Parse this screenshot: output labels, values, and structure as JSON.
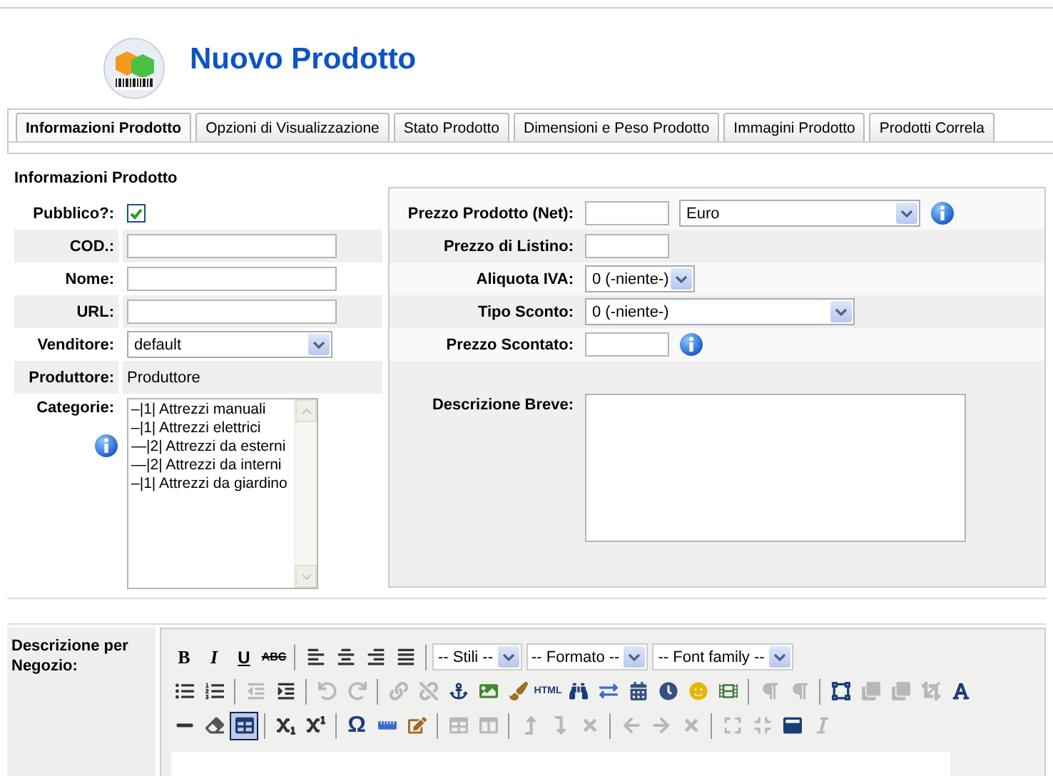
{
  "header": {
    "title": "Nuovo Prodotto"
  },
  "tabs": [
    {
      "label": "Informazioni Prodotto",
      "selected": true
    },
    {
      "label": "Opzioni di Visualizzazione",
      "selected": false
    },
    {
      "label": "Stato Prodotto",
      "selected": false
    },
    {
      "label": "Dimensioni e Peso Prodotto",
      "selected": false
    },
    {
      "label": "Immagini Prodotto",
      "selected": false
    },
    {
      "label": "Prodotti Correla",
      "selected": false
    }
  ],
  "info_section": {
    "heading": "Informazioni Prodotto",
    "rows": [
      {
        "kind": "checkbox",
        "label": "Pubblico?:",
        "checked": true
      },
      {
        "kind": "text",
        "label": "COD.:"
      },
      {
        "kind": "text",
        "label": "Nome:"
      },
      {
        "kind": "text",
        "label": "URL:"
      },
      {
        "kind": "select",
        "label": "Venditore:",
        "value": "default"
      },
      {
        "kind": "static",
        "label": "Produttore:",
        "value": "Produttore"
      },
      {
        "kind": "listbox",
        "label": "Categorie:",
        "info": true,
        "items": [
          "–|1| Attrezzi manuali",
          "–|1| Attrezzi elettrici",
          "—|2| Attrezzi da esterni",
          "—|2| Attrezzi da interni",
          "–|1| Attrezzi da giardino"
        ]
      }
    ]
  },
  "price_section": {
    "rows": [
      {
        "kind": "price",
        "label": "Prezzo Prodotto (Net):",
        "currency": "Euro",
        "info": true
      },
      {
        "kind": "text",
        "label": "Prezzo di Listino:"
      },
      {
        "kind": "dropdown",
        "label": "Aliquota IVA:",
        "value": "0 (-niente-)"
      },
      {
        "kind": "select",
        "label": "Tipo Sconto:",
        "value": "0 (-niente-)"
      },
      {
        "kind": "text",
        "label": "Prezzo Scontato:",
        "info": true
      },
      {
        "kind": "textarea",
        "label": "Descrizione Breve:"
      }
    ]
  },
  "editor": {
    "label": "Descrizione per Negozio:",
    "toolbar": [
      [
        {
          "kind": "bold",
          "label": "B",
          "disabled": false,
          "pressed": false
        },
        {
          "kind": "italic",
          "label": "I",
          "disabled": false,
          "pressed": false
        },
        {
          "kind": "underline",
          "label": "U",
          "disabled": false,
          "pressed": false
        },
        {
          "kind": "strike",
          "label": "ABC",
          "disabled": false,
          "pressed": false
        },
        {
          "kind": "separator"
        },
        {
          "kind": "align-left",
          "disabled": false,
          "pressed": false
        },
        {
          "kind": "align-center",
          "disabled": false,
          "pressed": false
        },
        {
          "kind": "align-right",
          "disabled": false,
          "pressed": false
        },
        {
          "kind": "align-justify",
          "disabled": false,
          "pressed": false
        },
        {
          "kind": "separator"
        },
        {
          "kind": "select",
          "label": "-- Stili --"
        },
        {
          "kind": "select",
          "label": "-- Formato --"
        },
        {
          "kind": "select",
          "label": "-- Font family --"
        }
      ],
      [
        {
          "kind": "bullets",
          "disabled": false,
          "pressed": false
        },
        {
          "kind": "numbers",
          "disabled": false,
          "pressed": false
        },
        {
          "kind": "separator"
        },
        {
          "kind": "outdent",
          "disabled": true,
          "pressed": false
        },
        {
          "kind": "indent",
          "disabled": false,
          "pressed": false
        },
        {
          "kind": "separator"
        },
        {
          "kind": "undo",
          "disabled": true,
          "pressed": false
        },
        {
          "kind": "redo",
          "disabled": true,
          "pressed": false
        },
        {
          "kind": "separator"
        },
        {
          "kind": "link",
          "disabled": true,
          "pressed": false
        },
        {
          "kind": "unlink",
          "disabled": true,
          "pressed": false
        },
        {
          "kind": "anchor",
          "disabled": false,
          "pressed": false
        },
        {
          "kind": "image",
          "disabled": false,
          "pressed": false
        },
        {
          "kind": "cleanup",
          "disabled": false,
          "pressed": false
        },
        {
          "kind": "html",
          "label": "HTML",
          "disabled": false,
          "pressed": false
        },
        {
          "kind": "search",
          "disabled": false,
          "pressed": false
        },
        {
          "kind": "replace",
          "disabled": false,
          "pressed": false
        },
        {
          "kind": "date",
          "disabled": false,
          "pressed": false
        },
        {
          "kind": "time",
          "disabled": false,
          "pressed": false
        },
        {
          "kind": "emoticon",
          "disabled": false,
          "pressed": false
        },
        {
          "kind": "media",
          "disabled": false,
          "pressed": false
        },
        {
          "kind": "separator"
        },
        {
          "kind": "ltr",
          "disabled": true,
          "pressed": false
        },
        {
          "kind": "rtl",
          "disabled": true,
          "pressed": false
        },
        {
          "kind": "separator"
        },
        {
          "kind": "visual-aid",
          "disabled": false,
          "pressed": false
        },
        {
          "kind": "layer-back",
          "disabled": true,
          "pressed": false
        },
        {
          "kind": "layer-front",
          "disabled": true,
          "pressed": false
        },
        {
          "kind": "crop",
          "disabled": true,
          "pressed": false
        },
        {
          "kind": "text-color",
          "disabled": false,
          "pressed": false
        }
      ],
      [
        {
          "kind": "rule",
          "disabled": false,
          "pressed": false
        },
        {
          "kind": "eraser",
          "disabled": false,
          "pressed": false
        },
        {
          "kind": "table",
          "disabled": false,
          "pressed": true
        },
        {
          "kind": "separator"
        },
        {
          "kind": "subscript",
          "disabled": false,
          "pressed": false
        },
        {
          "kind": "superscript",
          "disabled": false,
          "pressed": false
        },
        {
          "kind": "separator"
        },
        {
          "kind": "charmap",
          "label": "Ω",
          "disabled": false,
          "pressed": false
        },
        {
          "kind": "advanced-rule",
          "disabled": false,
          "pressed": false
        },
        {
          "kind": "form",
          "disabled": false,
          "pressed": false
        },
        {
          "kind": "separator"
        },
        {
          "kind": "table-props",
          "disabled": true,
          "pressed": false
        },
        {
          "kind": "cell-props",
          "disabled": true,
          "pressed": false
        },
        {
          "kind": "separator"
        },
        {
          "kind": "row-before",
          "disabled": true,
          "pressed": false
        },
        {
          "kind": "row-after",
          "disabled": true,
          "pressed": false
        },
        {
          "kind": "row-delete",
          "disabled": true,
          "pressed": false
        },
        {
          "kind": "separator"
        },
        {
          "kind": "col-before",
          "disabled": true,
          "pressed": false
        },
        {
          "kind": "col-after",
          "disabled": true,
          "pressed": false
        },
        {
          "kind": "col-delete",
          "disabled": true,
          "pressed": false
        },
        {
          "kind": "separator"
        },
        {
          "kind": "split-cells",
          "disabled": true,
          "pressed": false
        },
        {
          "kind": "merge-cells",
          "disabled": true,
          "pressed": false
        },
        {
          "kind": "fullscreen",
          "disabled": false,
          "pressed": false
        },
        {
          "kind": "styles",
          "disabled": true,
          "pressed": false
        }
      ]
    ]
  }
}
